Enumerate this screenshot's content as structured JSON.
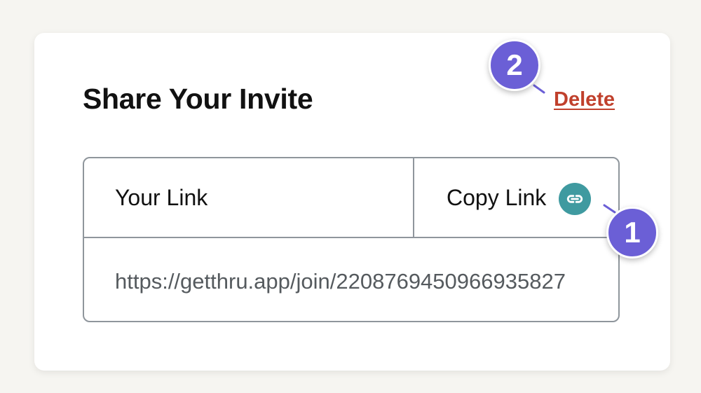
{
  "card": {
    "title": "Share Your Invite",
    "delete_label": "Delete"
  },
  "link_table": {
    "header_label": "Your Link",
    "copy_label": "Copy Link",
    "copy_icon": "link-icon",
    "url": "https://getthru.app/join/2208769450966935827"
  },
  "annotations": {
    "step_1": "1",
    "step_2": "2"
  },
  "colors": {
    "background": "#f6f5f1",
    "card": "#ffffff",
    "delete_link": "#c0402c",
    "copy_icon_bg": "#3f9aa0",
    "badge": "#6b5fd6",
    "border": "#8f969c"
  }
}
